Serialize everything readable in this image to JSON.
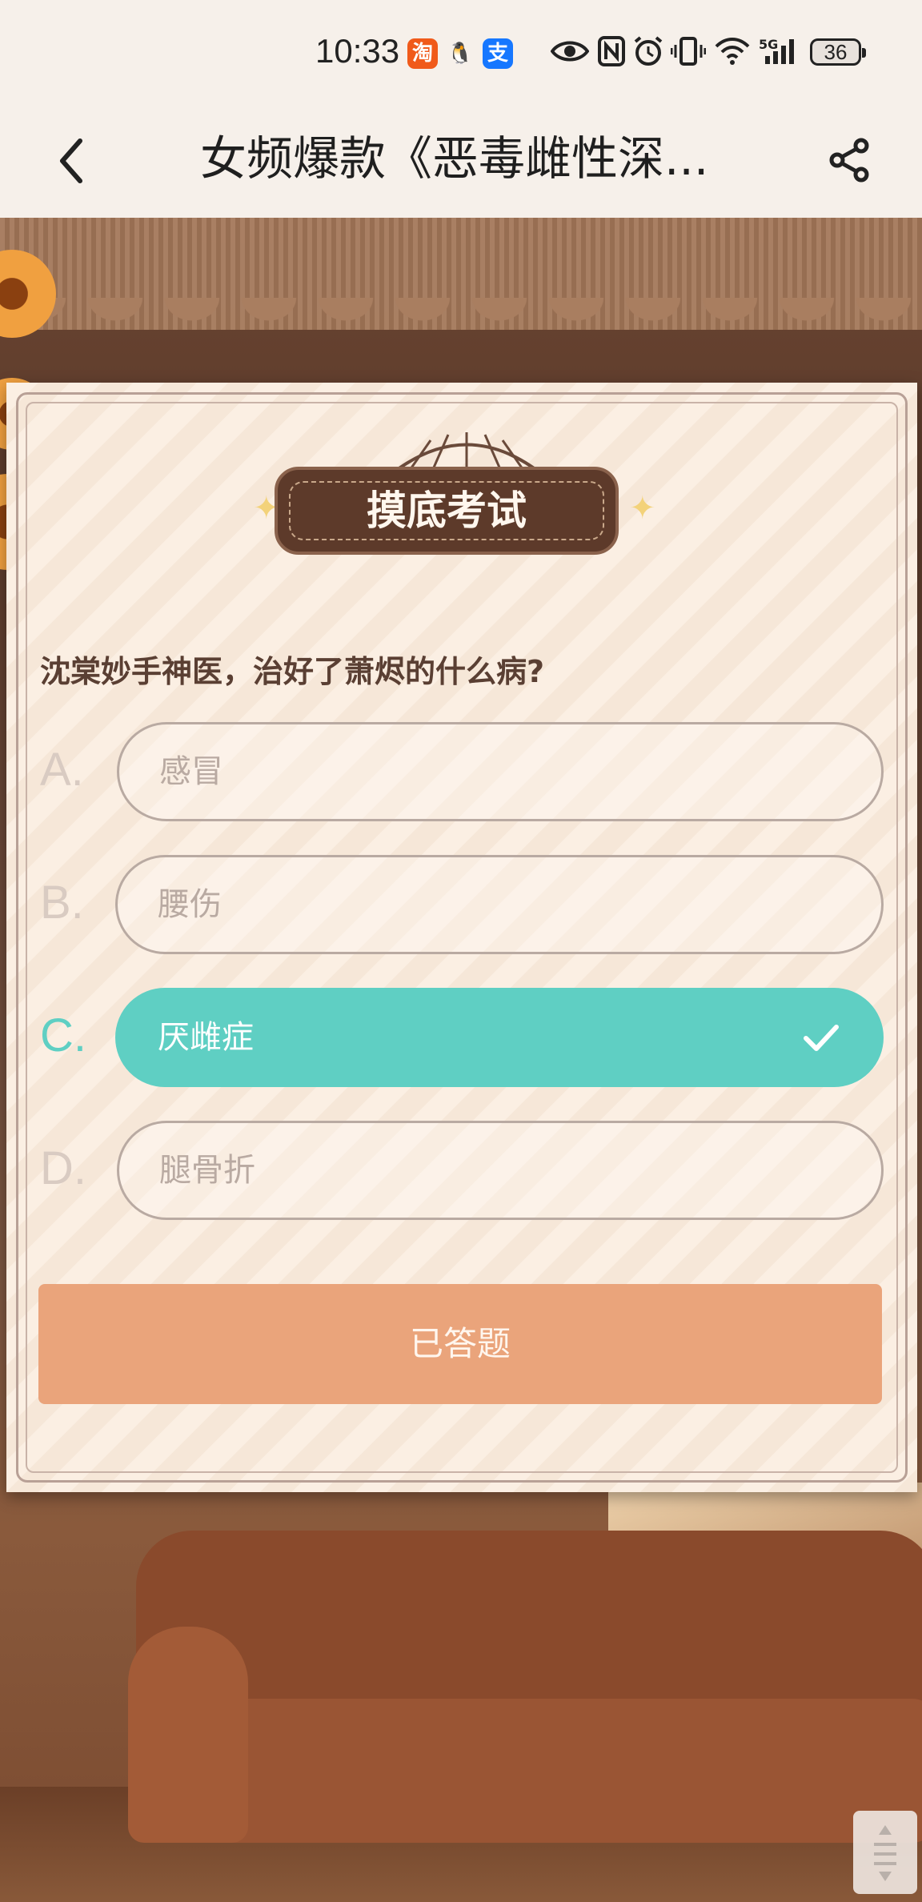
{
  "status_bar": {
    "time": "10:33",
    "app_badges": [
      {
        "icon": "taobao-icon",
        "glyph": "淘",
        "color": "#f05a1a"
      },
      {
        "icon": "qq-icon",
        "glyph": "🐧",
        "color": "#ffffff"
      },
      {
        "icon": "alipay-icon",
        "glyph": "支",
        "color": "#1677ff"
      }
    ],
    "network": "5G",
    "battery": "36"
  },
  "header": {
    "title": "女频爆款《恶毒雌性深...",
    "back_icon": "chevron-left-icon",
    "share_icon": "share-icon"
  },
  "quiz": {
    "banner_title": "摸底考试",
    "question": "沈棠妙手神医，治好了萧烬的什么病?",
    "options": [
      {
        "letter": "A.",
        "text": "感冒",
        "selected": false
      },
      {
        "letter": "B.",
        "text": "腰伤",
        "selected": false
      },
      {
        "letter": "C.",
        "text": "厌雌症",
        "selected": true
      },
      {
        "letter": "D.",
        "text": "腿骨折",
        "selected": false
      }
    ],
    "submit_label": "已答题"
  },
  "colors": {
    "accent_selected": "#5fcfc3",
    "submit_button": "#eaa47b",
    "card_bg": "#fbefe3",
    "banner_bg": "#5d3a2a"
  }
}
